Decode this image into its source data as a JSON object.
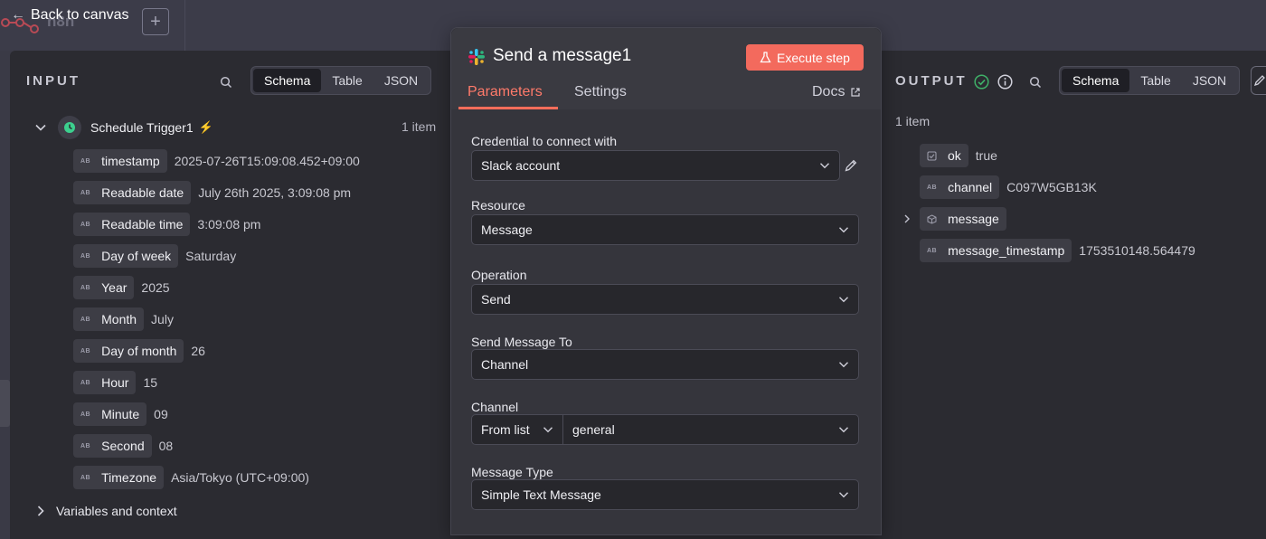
{
  "topbar": {
    "back_label": "Back to canvas",
    "workflow_name": "n8n",
    "add_symbol": "+"
  },
  "input": {
    "title": "INPUT",
    "view_tabs": [
      "Schema",
      "Table",
      "JSON"
    ],
    "active_tab": "Schema",
    "node": {
      "name": "Schedule Trigger1",
      "count": "1 item"
    },
    "fields": [
      {
        "key": "timestamp",
        "value": "2025-07-26T15:09:08.452+09:00"
      },
      {
        "key": "Readable date",
        "value": "July 26th 2025, 3:09:08 pm"
      },
      {
        "key": "Readable time",
        "value": "3:09:08 pm"
      },
      {
        "key": "Day of week",
        "value": "Saturday"
      },
      {
        "key": "Year",
        "value": "2025"
      },
      {
        "key": "Month",
        "value": "July"
      },
      {
        "key": "Day of month",
        "value": "26"
      },
      {
        "key": "Hour",
        "value": "15"
      },
      {
        "key": "Minute",
        "value": "09"
      },
      {
        "key": "Second",
        "value": "08"
      },
      {
        "key": "Timezone",
        "value": "Asia/Tokyo (UTC+09:00)"
      }
    ],
    "type_badge": "AB",
    "variables_label": "Variables and context"
  },
  "modal": {
    "title": "Send a message1",
    "execute_label": "Execute step",
    "tabs": {
      "parameters": "Parameters",
      "settings": "Settings",
      "docs": "Docs"
    },
    "fields": {
      "credential": {
        "label": "Credential to connect with",
        "value": "Slack account"
      },
      "resource": {
        "label": "Resource",
        "value": "Message"
      },
      "operation": {
        "label": "Operation",
        "value": "Send"
      },
      "send_to": {
        "label": "Send Message To",
        "value": "Channel"
      },
      "channel": {
        "label": "Channel",
        "mode": "From list",
        "value": "general"
      },
      "message_type": {
        "label": "Message Type",
        "value": "Simple Text Message"
      }
    }
  },
  "output": {
    "title": "OUTPUT",
    "view_tabs": [
      "Schema",
      "Table",
      "JSON"
    ],
    "active_tab": "Schema",
    "count": "1 item",
    "fields": [
      {
        "key": "ok",
        "value": "true",
        "type": "boolean"
      },
      {
        "key": "channel",
        "value": "C097W5GB13K",
        "type": "string"
      },
      {
        "key": "message",
        "value": "",
        "type": "object"
      },
      {
        "key": "message_timestamp",
        "value": "1753510148.564479",
        "type": "string"
      }
    ]
  },
  "colors": {
    "accent": "#ff6d5a",
    "success": "#3fb068",
    "trigger_green": "#3ccf8e"
  }
}
